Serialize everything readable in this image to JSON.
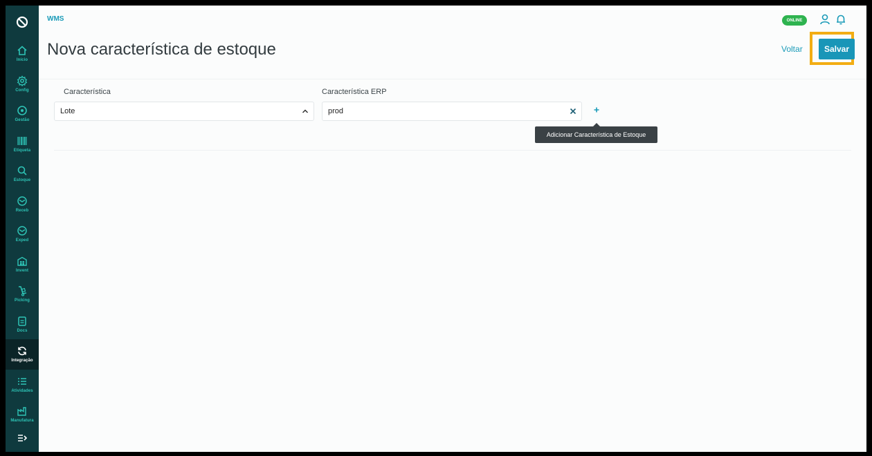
{
  "app": {
    "name": "WMS",
    "status_badge": "ONLINE"
  },
  "page": {
    "title": "Nova característica de estoque"
  },
  "actions": {
    "back_label": "Voltar",
    "save_label": "Salvar"
  },
  "sidebar": {
    "items": [
      {
        "label": "Início",
        "icon": "home-icon"
      },
      {
        "label": "Config",
        "icon": "gear-icon"
      },
      {
        "label": "Gestão",
        "icon": "location-pin-icon"
      },
      {
        "label": "Etiqueta",
        "icon": "barcode-icon"
      },
      {
        "label": "Estoque",
        "icon": "search-icon"
      },
      {
        "label": "Receb",
        "icon": "box-icon"
      },
      {
        "label": "Exped",
        "icon": "box-icon"
      },
      {
        "label": "Invent",
        "icon": "warehouse-icon"
      },
      {
        "label": "Picking",
        "icon": "hand-truck-icon"
      },
      {
        "label": "Docs",
        "icon": "document-icon"
      },
      {
        "label": "Integração",
        "icon": "sync-icon",
        "active": true
      },
      {
        "label": "Atividades",
        "icon": "list-icon"
      },
      {
        "label": "Manufatura",
        "icon": "factory-icon"
      }
    ],
    "expand_icon": "expand-menu-icon"
  },
  "form": {
    "characteristic": {
      "label": "Característica",
      "value": "Lote"
    },
    "erp_characteristic": {
      "label": "Característica ERP",
      "value": "prod"
    },
    "add_tooltip": "Adicionar Característica de Estoque"
  },
  "colors": {
    "sidebar_bg": "#0f3a3e",
    "accent": "#1a9bb8",
    "icon_teal": "#2ec4b6",
    "online_green": "#2eb34f",
    "highlight": "#f2ad13"
  }
}
